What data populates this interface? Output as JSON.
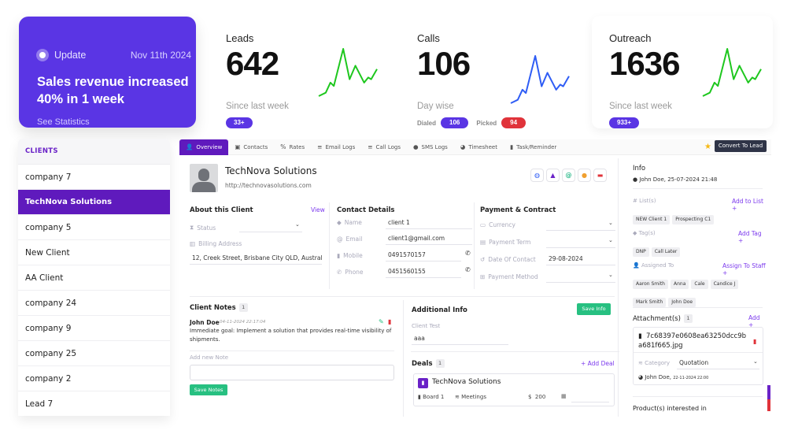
{
  "update_card": {
    "label": "Update",
    "date": "Nov 11th 2024",
    "headline": "Sales revenue increased 40% in 1 week",
    "link": "See Statistics"
  },
  "stats": {
    "leads": {
      "title": "Leads",
      "value": "642",
      "subtitle": "Since last week",
      "badge": "33+",
      "sparkline_color": "#1ec71e"
    },
    "calls": {
      "title": "Calls",
      "value": "106",
      "subtitle": "Day wise",
      "dialed_label": "Dialed",
      "dialed_value": "106",
      "picked_label": "Picked",
      "picked_value": "94",
      "sparkline_color": "#2f5df5"
    },
    "outreach": {
      "title": "Outreach",
      "value": "1636",
      "subtitle": "Since last week",
      "badge": "933+",
      "sparkline_color": "#1ec71e"
    }
  },
  "sparkline": [
    2,
    4,
    10,
    8,
    30,
    12,
    20,
    10,
    13,
    12,
    18
  ],
  "clients": {
    "header": "CLIENTS",
    "items": [
      "company 7",
      "TechNova Solutions",
      "company 5",
      "New Client",
      "AA Client",
      "company 24",
      "company 9",
      "company 25",
      "company 2",
      "Lead 7"
    ],
    "active_index": 1
  },
  "tabs": [
    {
      "label": "Overview",
      "icon": "user-icon",
      "glyph": "👤"
    },
    {
      "label": "Contacts",
      "icon": "contact-book-icon",
      "glyph": "▣"
    },
    {
      "label": "Rates",
      "icon": "percent-icon",
      "glyph": "%"
    },
    {
      "label": "Email Logs",
      "icon": "list-icon",
      "glyph": "≡"
    },
    {
      "label": "Call Logs",
      "icon": "list-icon",
      "glyph": "≡"
    },
    {
      "label": "SMS Logs",
      "icon": "chat-icon",
      "glyph": "●"
    },
    {
      "label": "Timesheet",
      "icon": "clock-icon",
      "glyph": "◕"
    },
    {
      "label": "Task/Reminder",
      "icon": "clipboard-icon",
      "glyph": "▮"
    }
  ],
  "toolbar": {
    "convert_label": "Convert To Lead"
  },
  "company": {
    "name": "TechNova Solutions",
    "url": "http://technovasolutions.com"
  },
  "about": {
    "title": "About this Client",
    "view_link": "View",
    "status_label": "Status",
    "status_value": "",
    "billing_label": "Billing Address",
    "billing_value": "12, Creek Street, Brisbane City QLD, Australi"
  },
  "contact": {
    "title": "Contact Details",
    "name_label": "Name",
    "name_value": "client 1",
    "email_label": "Email",
    "email_value": "client1@gmail.com",
    "mobile_label": "Mobile",
    "mobile_value": "0491570157",
    "phone_label": "Phone",
    "phone_value": "0451560155"
  },
  "payment": {
    "title": "Payment & Contract",
    "currency_label": "Currency",
    "currency_value": "",
    "term_label": "Payment Term",
    "term_value": "",
    "date_label": "Date Of Contact",
    "date_value": "29-08-2024",
    "method_label": "Payment Method",
    "method_value": ""
  },
  "notes": {
    "title": "Client Notes",
    "count": "1",
    "author": "John Doe",
    "timestamp": "04-11-2024 22:17:04",
    "text": "Immediate goal: Implement a solution that provides real-time visibility of shipments.",
    "add_label": "Add new Note",
    "textarea_value": "",
    "save_label": "Save Notes"
  },
  "additional": {
    "title": "Additional Info",
    "save_label": "Save Info",
    "field_label": "Client Test",
    "field_value": "aaa"
  },
  "deals": {
    "title": "Deals",
    "count": "1",
    "add_label": "+ Add Deal",
    "deal_name": "TechNova Solutions",
    "board": "Board 1",
    "stage": "Meetings",
    "currency": "$",
    "amount": "200",
    "date_value": ""
  },
  "info": {
    "title": "Info",
    "created": "John Doe, 25-07-2024 21:48",
    "lists_label": "List(s)",
    "add_list": "Add to List +",
    "lists": [
      "NEW Client 1",
      "Prospecting C1"
    ],
    "tags_label": "Tag(s)",
    "add_tag": "Add Tag +",
    "tags": [
      "DNP",
      "Call Later"
    ],
    "assigned_label": "Assigned To",
    "assign_link": "Assign To Staff +",
    "assigned": [
      "Aaron Smith",
      "Anna",
      "Cale",
      "Candice J",
      "Mark Smith",
      "John Doe"
    ],
    "attachments_label": "Attachment(s)",
    "attachments_count": "1",
    "add_attachment": "Add +",
    "file_name_1": "7c68397e0608ea63250dcc9b",
    "file_name_2": "a681f665.jpg",
    "category_label": "Category",
    "category_value": "Quotation",
    "uploaded_by": "John Doe,",
    "uploaded_at": "22-11-2024 22:00",
    "products_label": "Product(s) interested in"
  },
  "colors": {
    "brand": "#5f1abd",
    "accent": "#5a35e4",
    "success": "#27c081",
    "danger": "#e0333a"
  }
}
